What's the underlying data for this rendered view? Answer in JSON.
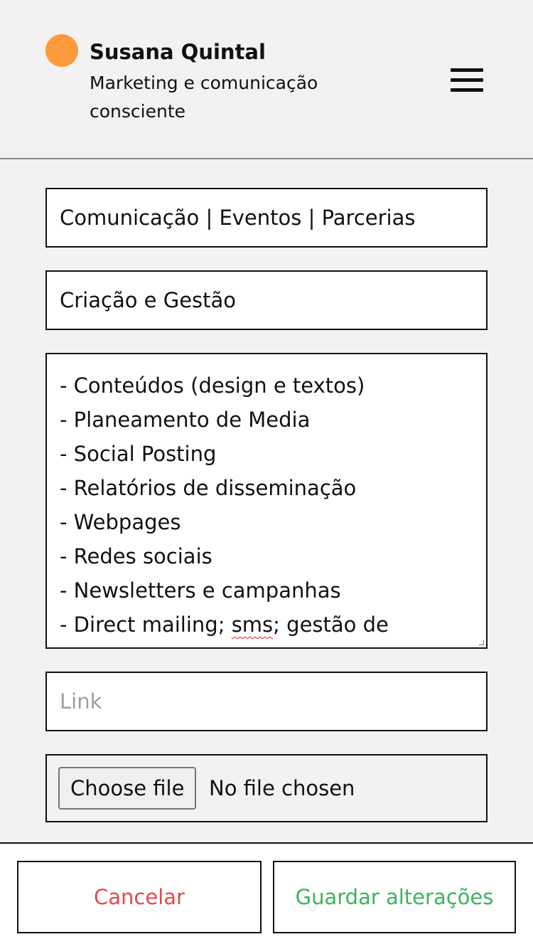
{
  "header": {
    "name": "Susana Quintal",
    "tagline": "Marketing e comunicação consciente",
    "avatar_color": "#ff9a3c",
    "menu_icon": "hamburger-menu-icon"
  },
  "form": {
    "title_value": "Comunicação | Eventos | Parcerias",
    "subtitle_value": "Criação e Gestão",
    "description_lines": [
      "- Conteúdos (design e textos)",
      "- Planeamento de Media",
      "- Social Posting",
      "- Relatórios de disseminação",
      "- Webpages",
      "- Redes sociais",
      "- Newsletters e campanhas",
      "- Direct mailing; sms; gestão de"
    ],
    "link_placeholder": "Link",
    "file_button_label": "Choose file",
    "file_status": "No file chosen"
  },
  "actions": {
    "cancel_label": "Cancelar",
    "cancel_color": "#e5484d",
    "save_label": "Guardar alterações",
    "save_color": "#3cb45a"
  }
}
